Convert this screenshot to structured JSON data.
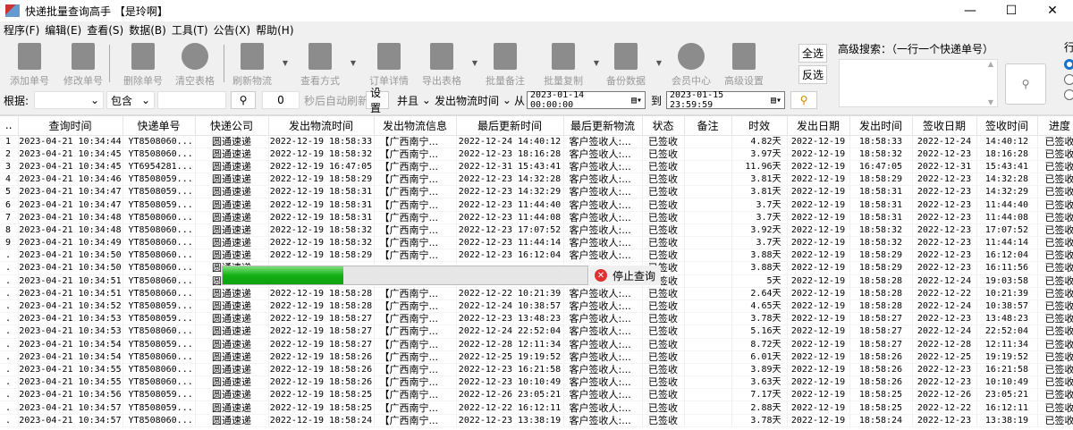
{
  "window": {
    "title": "快递批量查询高手 【是玲啊】",
    "minimize": "—",
    "maximize": "☐",
    "close": "✕"
  },
  "menu": [
    "程序(F)",
    "编辑(E)",
    "查看(S)",
    "数据(B)",
    "工具(T)",
    "公告(X)",
    "帮助(H)"
  ],
  "toolbar": [
    {
      "label": "添加单号",
      "icon": "add-doc-icon"
    },
    {
      "label": "修改单号",
      "icon": "edit-pencil-icon"
    },
    {
      "label": "删除单号",
      "icon": "delete-doc-icon"
    },
    {
      "label": "清空表格",
      "icon": "clear-x-icon"
    },
    {
      "label": "刷新物流",
      "icon": "refresh-doc-icon"
    },
    {
      "label": "查看方式",
      "icon": "view-doc-icon"
    },
    {
      "label": "订单详情",
      "icon": "detail-doc-icon"
    },
    {
      "label": "导出表格",
      "icon": "export-icon"
    },
    {
      "label": "批量备注",
      "icon": "scroll-icon"
    },
    {
      "label": "批量复制",
      "icon": "copy-icon"
    },
    {
      "label": "备份数据",
      "icon": "backup-icon"
    },
    {
      "label": "会员中心",
      "icon": "clock-icon"
    },
    {
      "label": "高级设置",
      "icon": "settings-icon"
    }
  ],
  "select_all": "全选",
  "invert_select": "反选",
  "filter": {
    "by_label": "根据:",
    "by_value": "",
    "match": "包含",
    "keyword": "",
    "refresh_seconds": "0",
    "auto_refresh_label": "秒后自动刷新",
    "settings": "设置",
    "logic": "并且",
    "field": "发出物流时间",
    "from_label": "从",
    "from": "2023-01-14 00:00:00",
    "to_label": "到",
    "to": "2023-01-15 23:59:59"
  },
  "advanced": {
    "label": "高级搜索：（一行一个快递单号）",
    "value": ""
  },
  "group_label": "行",
  "columns": [
    "..",
    "查询时间",
    "快递单号",
    "快递公司",
    "发出物流时间",
    "发出物流信息",
    "最后更新时间",
    "最后更新物流",
    "状态",
    "备注",
    "时效",
    "发出日期",
    "发出时间",
    "签收日期",
    "签收时间",
    "进度"
  ],
  "rows": [
    [
      "1",
      "2023-04-21 10:34:44",
      "YT8508060...",
      "圆通速递",
      "2022-12-19 18:58:33",
      "【广西南宁...",
      "2022-12-24 14:40:12",
      "客户签收人:...",
      "已签收",
      "",
      "4.82天",
      "2022-12-19",
      "18:58:33",
      "2022-12-24",
      "14:40:12",
      "已签收"
    ],
    [
      "2",
      "2023-04-21 10:34:45",
      "YT8508060...",
      "圆通速递",
      "2022-12-19 18:58:32",
      "【广西南宁...",
      "2022-12-23 18:16:28",
      "客户签收人:...",
      "已签收",
      "",
      "3.97天",
      "2022-12-19",
      "18:58:32",
      "2022-12-23",
      "18:16:28",
      "已签收"
    ],
    [
      "3",
      "2023-04-21 10:34:45",
      "YT6954281...",
      "圆通速递",
      "2022-12-19 16:47:05",
      "【广西南宁...",
      "2022-12-31 15:43:41",
      "客户签收人:...",
      "已签收",
      "",
      "11.96天",
      "2022-12-19",
      "16:47:05",
      "2022-12-31",
      "15:43:41",
      "已签收"
    ],
    [
      "4",
      "2023-04-21 10:34:46",
      "YT8508059...",
      "圆通速递",
      "2022-12-19 18:58:29",
      "【广西南宁...",
      "2022-12-23 14:32:28",
      "客户签收人:...",
      "已签收",
      "",
      "3.81天",
      "2022-12-19",
      "18:58:29",
      "2022-12-23",
      "14:32:28",
      "已签收"
    ],
    [
      "5",
      "2023-04-21 10:34:47",
      "YT8508059...",
      "圆通速递",
      "2022-12-19 18:58:31",
      "【广西南宁...",
      "2022-12-23 14:32:29",
      "客户签收人:...",
      "已签收",
      "",
      "3.81天",
      "2022-12-19",
      "18:58:31",
      "2022-12-23",
      "14:32:29",
      "已签收"
    ],
    [
      "6",
      "2023-04-21 10:34:47",
      "YT8508059...",
      "圆通速递",
      "2022-12-19 18:58:31",
      "【广西南宁...",
      "2022-12-23 11:44:40",
      "客户签收人:...",
      "已签收",
      "",
      "3.7天",
      "2022-12-19",
      "18:58:31",
      "2022-12-23",
      "11:44:40",
      "已签收"
    ],
    [
      "7",
      "2023-04-21 10:34:48",
      "YT8508060...",
      "圆通速递",
      "2022-12-19 18:58:31",
      "【广西南宁...",
      "2022-12-23 11:44:08",
      "客户签收人:...",
      "已签收",
      "",
      "3.7天",
      "2022-12-19",
      "18:58:31",
      "2022-12-23",
      "11:44:08",
      "已签收"
    ],
    [
      "8",
      "2023-04-21 10:34:48",
      "YT8508060...",
      "圆通速递",
      "2022-12-19 18:58:32",
      "【广西南宁...",
      "2022-12-23 17:07:52",
      "客户签收人:...",
      "已签收",
      "",
      "3.92天",
      "2022-12-19",
      "18:58:32",
      "2022-12-23",
      "17:07:52",
      "已签收"
    ],
    [
      "9",
      "2023-04-21 10:34:49",
      "YT8508060...",
      "圆通速递",
      "2022-12-19 18:58:32",
      "【广西南宁...",
      "2022-12-23 11:44:14",
      "客户签收人:...",
      "已签收",
      "",
      "3.7天",
      "2022-12-19",
      "18:58:32",
      "2022-12-23",
      "11:44:14",
      "已签收"
    ],
    [
      ".",
      "2023-04-21 10:34:50",
      "YT8508060...",
      "圆通速递",
      "2022-12-19 18:58:29",
      "【广西南宁...",
      "2022-12-23 16:12:04",
      "客户签收人:...",
      "已签收",
      "",
      "3.88天",
      "2022-12-19",
      "18:58:29",
      "2022-12-23",
      "16:12:04",
      "已签收"
    ],
    [
      ".",
      "2023-04-21 10:34:50",
      "YT8508060...",
      "圆通速递",
      "",
      "",
      "",
      "",
      "已签收",
      "",
      "3.88天",
      "2022-12-19",
      "18:58:29",
      "2022-12-23",
      "16:11:56",
      "已签收"
    ],
    [
      ".",
      "2023-04-21 10:34:51",
      "YT8508060...",
      "圆通速递",
      "",
      "",
      "",
      "",
      "已签收",
      "",
      "5天",
      "2022-12-19",
      "18:58:28",
      "2022-12-24",
      "19:03:58",
      "已签收"
    ],
    [
      ".",
      "2023-04-21 10:34:51",
      "YT8508060...",
      "圆通速递",
      "2022-12-19 18:58:28",
      "【广西南宁...",
      "2022-12-22 10:21:39",
      "客户签收人:...",
      "已签收",
      "",
      "2.64天",
      "2022-12-19",
      "18:58:28",
      "2022-12-22",
      "10:21:39",
      "已签收"
    ],
    [
      ".",
      "2023-04-21 10:34:52",
      "YT8508059...",
      "圆通速递",
      "2022-12-19 18:58:28",
      "【广西南宁...",
      "2022-12-24 10:38:57",
      "客户签收人:...",
      "已签收",
      "",
      "4.65天",
      "2022-12-19",
      "18:58:28",
      "2022-12-24",
      "10:38:57",
      "已签收"
    ],
    [
      ".",
      "2023-04-21 10:34:53",
      "YT8508059...",
      "圆通速递",
      "2022-12-19 18:58:27",
      "【广西南宁...",
      "2022-12-23 13:48:23",
      "客户签收人:...",
      "已签收",
      "",
      "3.78天",
      "2022-12-19",
      "18:58:27",
      "2022-12-23",
      "13:48:23",
      "已签收"
    ],
    [
      ".",
      "2023-04-21 10:34:53",
      "YT8508060...",
      "圆通速递",
      "2022-12-19 18:58:27",
      "【广西南宁...",
      "2022-12-24 22:52:04",
      "客户签收人:...",
      "已签收",
      "",
      "5.16天",
      "2022-12-19",
      "18:58:27",
      "2022-12-24",
      "22:52:04",
      "已签收"
    ],
    [
      ".",
      "2023-04-21 10:34:54",
      "YT8508059...",
      "圆通速递",
      "2022-12-19 18:58:27",
      "【广西南宁...",
      "2022-12-28 12:11:34",
      "客户签收人:...",
      "已签收",
      "",
      "8.72天",
      "2022-12-19",
      "18:58:27",
      "2022-12-28",
      "12:11:34",
      "已签收"
    ],
    [
      ".",
      "2023-04-21 10:34:54",
      "YT8508060...",
      "圆通速递",
      "2022-12-19 18:58:26",
      "【广西南宁...",
      "2022-12-25 19:19:52",
      "客户签收人:...",
      "已签收",
      "",
      "6.01天",
      "2022-12-19",
      "18:58:26",
      "2022-12-25",
      "19:19:52",
      "已签收"
    ],
    [
      ".",
      "2023-04-21 10:34:55",
      "YT8508060...",
      "圆通速递",
      "2022-12-19 18:58:26",
      "【广西南宁...",
      "2022-12-23 16:21:58",
      "客户签收人:...",
      "已签收",
      "",
      "3.89天",
      "2022-12-19",
      "18:58:26",
      "2022-12-23",
      "16:21:58",
      "已签收"
    ],
    [
      ".",
      "2023-04-21 10:34:55",
      "YT8508060...",
      "圆通速递",
      "2022-12-19 18:58:26",
      "【广西南宁...",
      "2022-12-23 10:10:49",
      "客户签收人:...",
      "已签收",
      "",
      "3.63天",
      "2022-12-19",
      "18:58:26",
      "2022-12-23",
      "10:10:49",
      "已签收"
    ],
    [
      ".",
      "2023-04-21 10:34:56",
      "YT8508059...",
      "圆通速递",
      "2022-12-19 18:58:25",
      "【广西南宁...",
      "2022-12-26 23:05:21",
      "客户签收人:...",
      "已签收",
      "",
      "7.17天",
      "2022-12-19",
      "18:58:25",
      "2022-12-26",
      "23:05:21",
      "已签收"
    ],
    [
      ".",
      "2023-04-21 10:34:57",
      "YT8508059...",
      "圆通速递",
      "2022-12-19 18:58:25",
      "【广西南宁...",
      "2022-12-22 16:12:11",
      "客户签收人:...",
      "已签收",
      "",
      "2.88天",
      "2022-12-19",
      "18:58:25",
      "2022-12-22",
      "16:12:11",
      "已签收"
    ],
    [
      ".",
      "2023-04-21 10:34:57",
      "YT8508060...",
      "圆通速递",
      "2022-12-19 18:58:24",
      "【广西南宁...",
      "2022-12-23 13:38:19",
      "客户签收人:...",
      "已签收",
      "",
      "3.78天",
      "2022-12-19",
      "18:58:24",
      "2022-12-23",
      "13:38:19",
      "已签收"
    ]
  ],
  "progress": {
    "fraction": 0.33,
    "stop_label": "停止查询"
  },
  "colors": {
    "progress": "#14b014",
    "stop": "#e03030",
    "radio_on": "#1a6fc9"
  }
}
